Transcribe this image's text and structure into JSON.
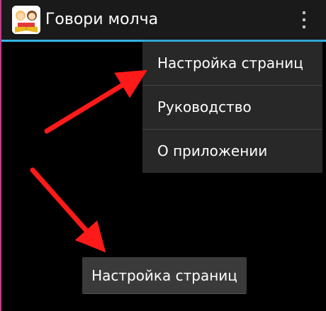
{
  "app": {
    "title": "Говори молча",
    "icon": "app-logo-icon",
    "icon_text": "Говори молча"
  },
  "action_bar": {
    "overflow_icon": "overflow-menu-icon"
  },
  "menu": {
    "items": [
      {
        "label": "Настройка страниц"
      },
      {
        "label": "Руководство"
      },
      {
        "label": "О приложении"
      }
    ]
  },
  "bottom_button": {
    "label": "Настройка страниц"
  },
  "colors": {
    "background": "#000000",
    "action_bar": "#1a1a1a",
    "accent_line": "#33b5e5",
    "menu_background": "#282828",
    "arrow": "#ff1a1a",
    "left_frame": "#c23c8c"
  }
}
